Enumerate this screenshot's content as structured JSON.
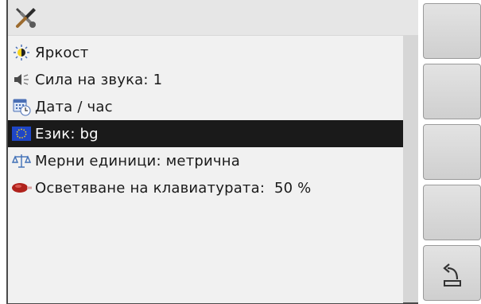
{
  "menu": {
    "items": [
      {
        "label": "Яркост",
        "icon": "brightness-icon"
      },
      {
        "label": "Сила на звука: 1",
        "icon": "speaker-volume-icon"
      },
      {
        "label": "Дата / час",
        "icon": "calendar-clock-icon"
      },
      {
        "label": "Език: bg",
        "icon": "eu-flag-icon",
        "selected": true
      },
      {
        "label": "Мерни единици: метрична",
        "icon": "balance-scale-icon"
      },
      {
        "label": "Осветяване на клавиатурата:  50 %",
        "icon": "keyboard-light-icon"
      }
    ]
  },
  "softkeys": [
    {
      "icon": ""
    },
    {
      "icon": ""
    },
    {
      "icon": ""
    },
    {
      "icon": ""
    },
    {
      "icon": "return-icon"
    }
  ],
  "colors": {
    "selection": "#1a1a1a",
    "list_bg": "#f1f1f1",
    "titlebar_bg": "#e6e6e6"
  }
}
